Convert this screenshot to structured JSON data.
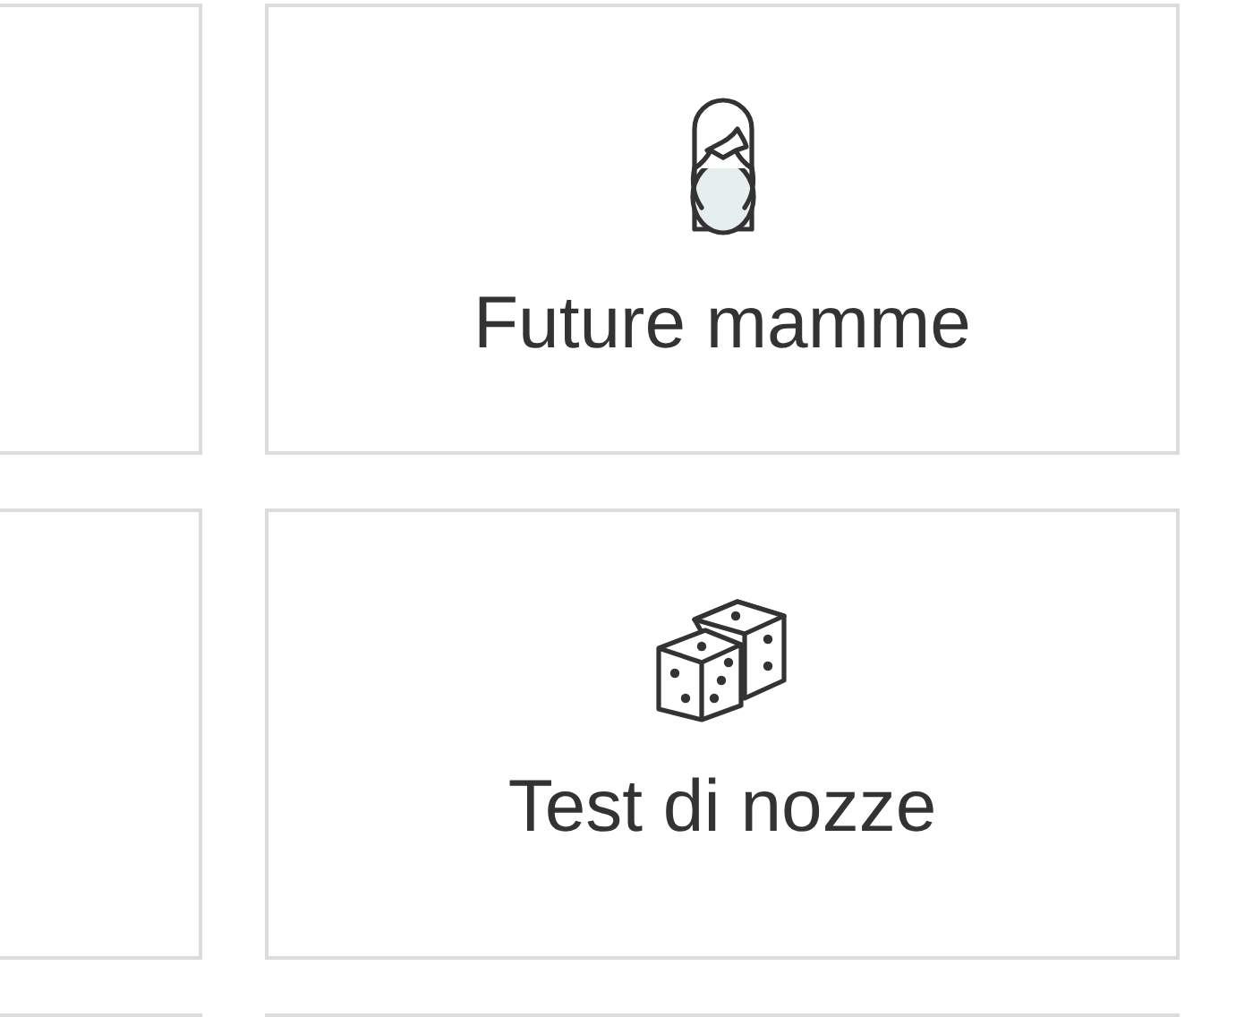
{
  "cards": [
    {
      "label": "Future mamme",
      "kind": "woman"
    },
    {
      "label": "Test di nozze",
      "kind": "dice"
    }
  ]
}
